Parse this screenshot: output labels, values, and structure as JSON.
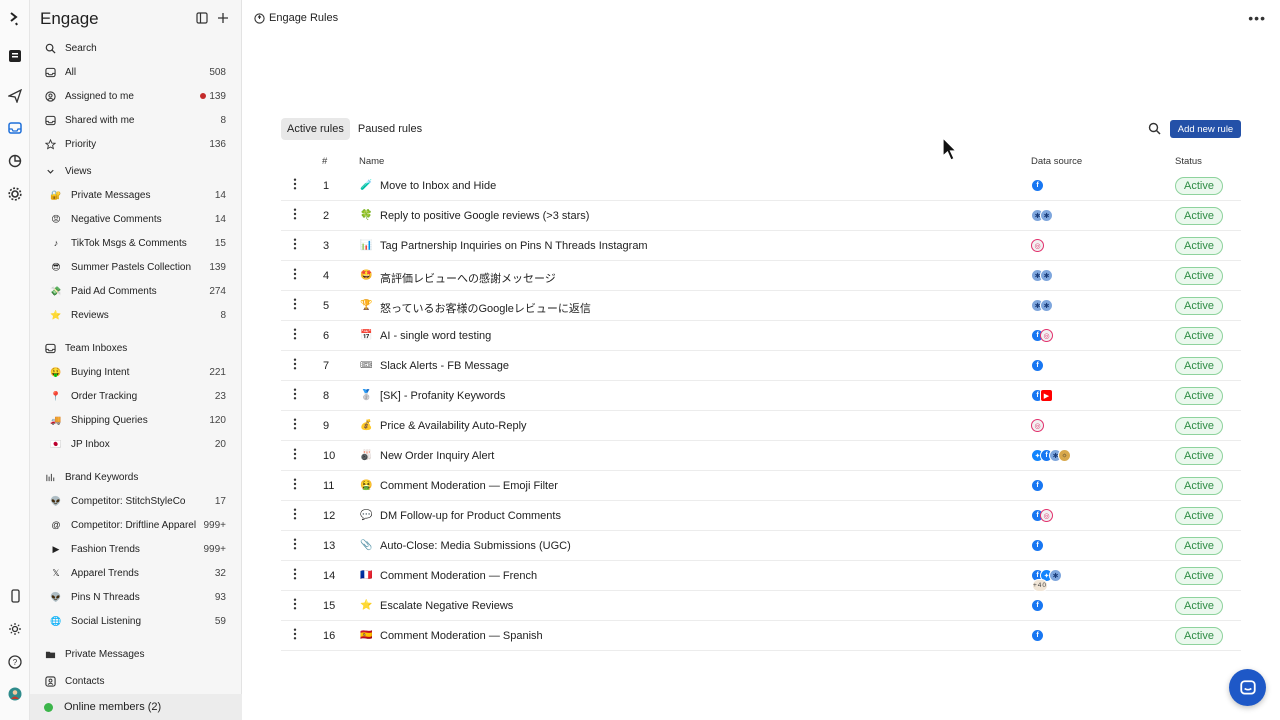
{
  "app": {
    "title": "Engage",
    "breadcrumb": "Engage Rules",
    "more_label": "•••"
  },
  "sidebar": {
    "top_items": [
      {
        "label": "Search",
        "count": "",
        "icon": "search-icon"
      },
      {
        "label": "All",
        "count": "508",
        "icon": "inbox-icon"
      },
      {
        "label": "Assigned to me",
        "count": "139",
        "icon": "user-circle-icon"
      },
      {
        "label": "Shared with me",
        "count": "8",
        "icon": "shared-inbox-icon"
      },
      {
        "label": "Priority",
        "count": "136",
        "icon": "star-icon"
      }
    ],
    "views_label": "Views",
    "views": [
      {
        "label": "Private Messages",
        "count": "14",
        "emoji": "🔐"
      },
      {
        "label": "Negative Comments",
        "count": "14",
        "emoji": "😡"
      },
      {
        "label": "TikTok Msgs & Comments",
        "count": "15",
        "emoji": "♪"
      },
      {
        "label": "Summer Pastels Collection",
        "count": "139",
        "emoji": "😎"
      },
      {
        "label": "Paid Ad Comments",
        "count": "274",
        "emoji": "💸"
      },
      {
        "label": "Reviews",
        "count": "8",
        "emoji": "⭐"
      }
    ],
    "team_label": "Team Inboxes",
    "teams": [
      {
        "label": "Buying Intent",
        "count": "221",
        "emoji": "🤑"
      },
      {
        "label": "Order Tracking",
        "count": "23",
        "emoji": "📍"
      },
      {
        "label": "Shipping Queries",
        "count": "120",
        "emoji": "🚚"
      },
      {
        "label": "JP Inbox",
        "count": "20",
        "emoji": "🇯🇵"
      }
    ],
    "brand_label": "Brand Keywords",
    "brands": [
      {
        "label": "Competitor: StitchStyleCo",
        "count": "17",
        "emoji": "👽"
      },
      {
        "label": "Competitor: Driftline Apparel",
        "count": "999+",
        "emoji": "@"
      },
      {
        "label": "Fashion Trends",
        "count": "999+",
        "emoji": "▶"
      },
      {
        "label": "Apparel Trends",
        "count": "32",
        "emoji": "𝕏"
      },
      {
        "label": "Pins N Threads",
        "count": "93",
        "emoji": "👽"
      },
      {
        "label": "Social Listening",
        "count": "59",
        "emoji": "🌐"
      }
    ],
    "private_messages": "Private Messages",
    "contacts": "Contacts",
    "online_members": "Online members (2)"
  },
  "rules": {
    "tabs": [
      "Active rules",
      "Paused rules"
    ],
    "add_button": "Add new rule",
    "columns": {
      "num": "#",
      "name": "Name",
      "source": "Data source",
      "status": "Status"
    },
    "rows": [
      {
        "num": "1",
        "emoji": "🧪",
        "name": "Move to Inbox and Hide",
        "sources": [
          "fb"
        ],
        "status": "Active"
      },
      {
        "num": "2",
        "emoji": "🍀",
        "name": "Reply to positive Google reviews (>3 stars)",
        "sources": [
          "gg",
          "gg"
        ],
        "status": "Active"
      },
      {
        "num": "3",
        "emoji": "📊",
        "name": "Tag Partnership Inquiries on Pins N Threads Instagram",
        "sources": [
          "ig"
        ],
        "status": "Active"
      },
      {
        "num": "4",
        "emoji": "🤩",
        "name": "高評価レビューへの感謝メッセージ",
        "sources": [
          "gg",
          "gg"
        ],
        "status": "Active"
      },
      {
        "num": "5",
        "emoji": "🏆",
        "name": "怒っているお客様のGoogleレビューに返信",
        "sources": [
          "gg",
          "gg"
        ],
        "status": "Active"
      },
      {
        "num": "6",
        "emoji": "📅",
        "name": "AI - single word testing",
        "sources": [
          "fb",
          "ig"
        ],
        "status": "Active"
      },
      {
        "num": "7",
        "emoji": "🎟",
        "name": "Slack Alerts - FB Message",
        "sources": [
          "fb"
        ],
        "status": "Active"
      },
      {
        "num": "8",
        "emoji": "🥈",
        "name": "[SK] - Profanity Keywords",
        "sources": [
          "fb",
          "yt"
        ],
        "status": "Active"
      },
      {
        "num": "9",
        "emoji": "💰",
        "name": "Price & Availability Auto-Reply",
        "sources": [
          "ig"
        ],
        "status": "Active"
      },
      {
        "num": "10",
        "emoji": "🎳",
        "name": "New Order Inquiry Alert",
        "sources": [
          "bs",
          "fb",
          "gg",
          "tk"
        ],
        "status": "Active"
      },
      {
        "num": "11",
        "emoji": "🤮",
        "name": "Comment Moderation — Emoji Filter",
        "sources": [
          "fb"
        ],
        "status": "Active"
      },
      {
        "num": "12",
        "emoji": "💬",
        "name": "DM Follow-up for Product Comments",
        "sources": [
          "fb",
          "ig"
        ],
        "status": "Active"
      },
      {
        "num": "13",
        "emoji": "📎",
        "name": "Auto-Close: Media Submissions (UGC)",
        "sources": [
          "fb"
        ],
        "status": "Active"
      },
      {
        "num": "14",
        "emoji": "🇫🇷",
        "name": "Comment Moderation — French",
        "sources": [
          "fb",
          "bs",
          "gg",
          "more"
        ],
        "more_label": "+40",
        "status": "Active"
      },
      {
        "num": "15",
        "emoji": "⭐",
        "name": "Escalate Negative Reviews",
        "sources": [
          "fb"
        ],
        "status": "Active"
      },
      {
        "num": "16",
        "emoji": "🇪🇸",
        "name": "Comment Moderation — Spanish",
        "sources": [
          "fb"
        ],
        "status": "Active"
      }
    ]
  },
  "colors": {
    "accent": "#2451a8",
    "status_active": "#2f8c45",
    "chat_button": "#1e58c7"
  }
}
